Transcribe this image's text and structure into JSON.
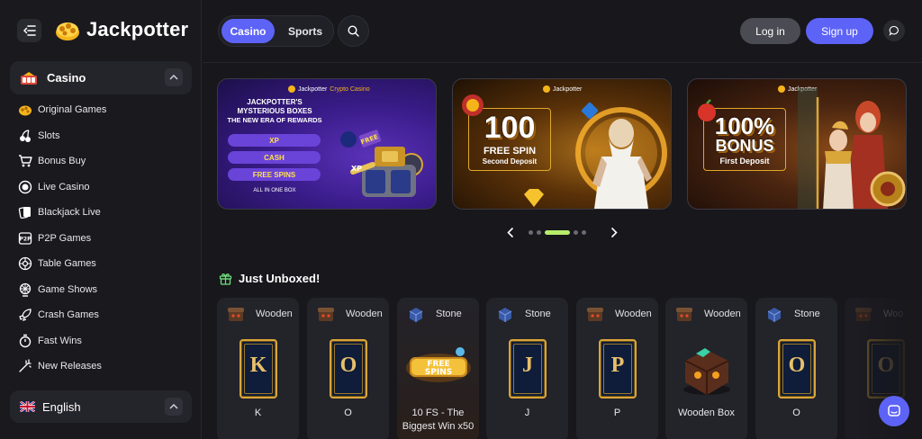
{
  "brand": {
    "name": "Jackpotter"
  },
  "sidebar": {
    "category": "Casino",
    "items": [
      {
        "label": "Original Games",
        "icon": "original-games-icon"
      },
      {
        "label": "Slots",
        "icon": "cherries-icon"
      },
      {
        "label": "Bonus Buy",
        "icon": "cart-icon"
      },
      {
        "label": "Live Casino",
        "icon": "live-icon"
      },
      {
        "label": "Blackjack Live",
        "icon": "cards-icon"
      },
      {
        "label": "P2P Games",
        "icon": "p2p-icon"
      },
      {
        "label": "Table Games",
        "icon": "roulette-icon"
      },
      {
        "label": "Game Shows",
        "icon": "wheel-icon"
      },
      {
        "label": "Crash Games",
        "icon": "rocket-icon"
      },
      {
        "label": "Fast Wins",
        "icon": "stopwatch-icon"
      },
      {
        "label": "New Releases",
        "icon": "sparkle-icon"
      }
    ],
    "language": "English"
  },
  "header": {
    "tabs": [
      {
        "label": "Casino",
        "active": true
      },
      {
        "label": "Sports",
        "active": false
      }
    ],
    "login": "Log in",
    "signup": "Sign up"
  },
  "banners": [
    {
      "brand": "Jackpotter",
      "brand_tag": "Crypto Casino",
      "title_line1": "JACKPOTTER'S",
      "title_line2": "MYSTERIOUS BOXES",
      "title_line3": "THE NEW ERA OF REWARDS",
      "pills": [
        "XP",
        "CASH",
        "FREE SPINS"
      ],
      "footer": "ALL IN ONE BOX",
      "chest_label_1": "FREE",
      "chest_label_2": "XP"
    },
    {
      "brand": "Jackpotter",
      "big": "100",
      "line1": "FREE SPIN",
      "line2": "Second Deposit"
    },
    {
      "brand": "Jackpotter",
      "big": "100%",
      "line1": "BONUS",
      "line2": "First Deposit"
    }
  ],
  "carousel": {
    "dots": 5,
    "active_index": 2
  },
  "unboxed": {
    "title": "Just Unboxed!",
    "cards": [
      {
        "type": "Wooden",
        "name": "K",
        "letter": "K",
        "kind": "tarot"
      },
      {
        "type": "Wooden",
        "name": "O",
        "letter": "O",
        "kind": "tarot"
      },
      {
        "type": "Stone",
        "name": "10 FS - The Biggest Win x50",
        "kind": "free-spins",
        "art_1": "FREE",
        "art_2": "SPINS"
      },
      {
        "type": "Stone",
        "name": "J",
        "letter": "J",
        "kind": "tarot"
      },
      {
        "type": "Wooden",
        "name": "P",
        "letter": "P",
        "kind": "tarot"
      },
      {
        "type": "Wooden",
        "name": "Wooden Box",
        "kind": "box"
      },
      {
        "type": "Stone",
        "name": "O",
        "letter": "O",
        "kind": "tarot"
      },
      {
        "type": "Woo",
        "name": "",
        "letter": "O",
        "kind": "tarot"
      }
    ]
  },
  "colors": {
    "accent": "#5d63f6",
    "carousel_active": "#b8ee6a",
    "background": "#17171c",
    "sidebar": "#19191e"
  }
}
